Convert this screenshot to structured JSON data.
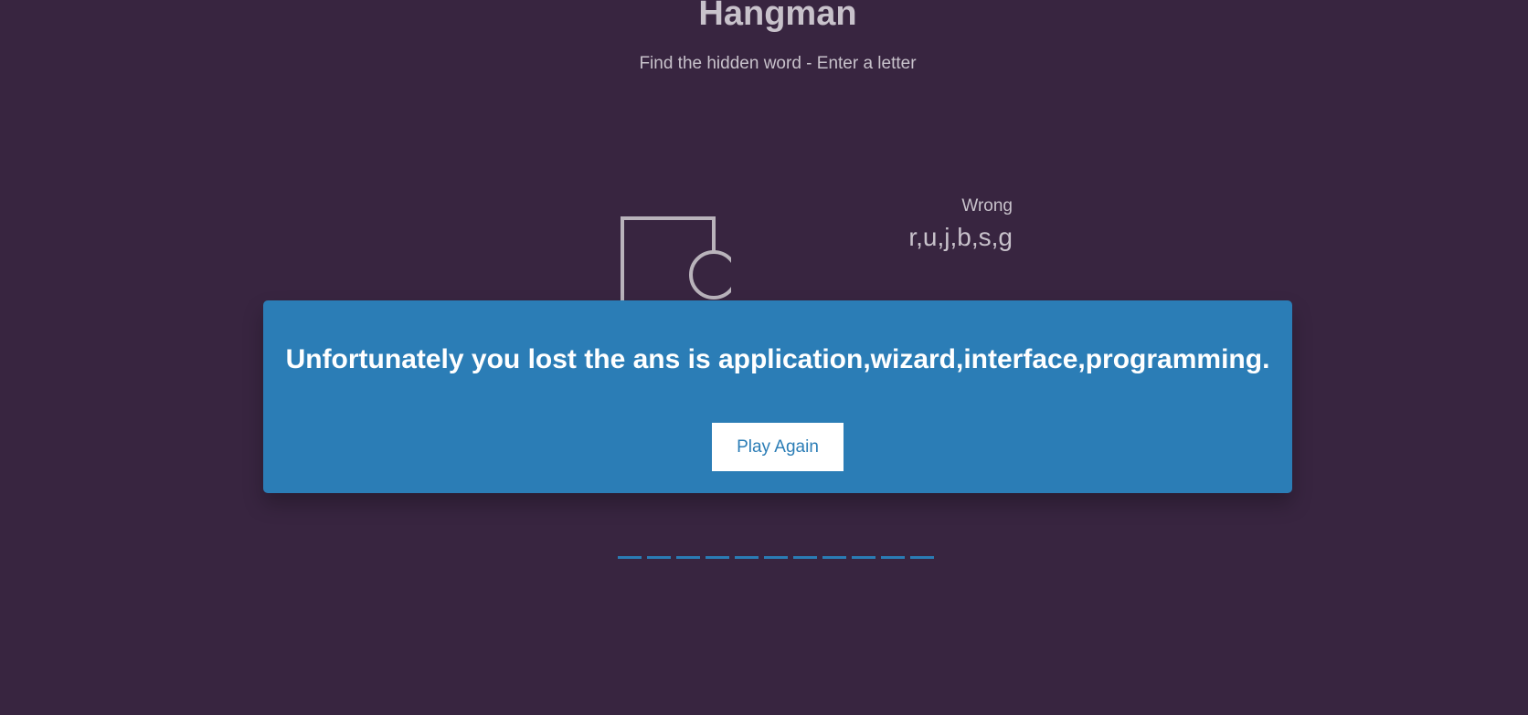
{
  "header": {
    "title": "Hangman",
    "subtitle": "Find the hidden word - Enter a letter"
  },
  "wrong": {
    "label": "Wrong",
    "letters": "r,u,j,b,s,g"
  },
  "word": {
    "slot_count": 11
  },
  "popup": {
    "message": "Unfortunately you lost the ans is application,wizard,interface,programming.",
    "play_again_label": "Play Again"
  },
  "colors": {
    "background": "#382540",
    "figure": "#b9b3bb",
    "popup": "#2b7db6",
    "word_slot": "#2a7cb5"
  }
}
